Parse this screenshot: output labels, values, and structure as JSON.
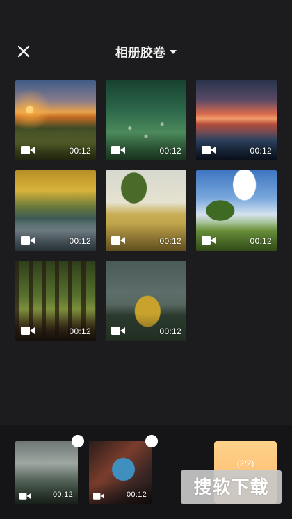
{
  "header": {
    "title": "相册胶卷",
    "close_icon": "close-icon",
    "dropdown_icon": "caret-down-icon"
  },
  "grid": {
    "items": [
      {
        "name": "sunset-field",
        "duration": "00:12"
      },
      {
        "name": "white-flowers",
        "duration": "00:12"
      },
      {
        "name": "sunset-reflection",
        "duration": "00:12"
      },
      {
        "name": "autumn-stream",
        "duration": "00:12"
      },
      {
        "name": "tree-in-field",
        "duration": "00:12"
      },
      {
        "name": "green-tree-sky",
        "duration": "00:12"
      },
      {
        "name": "forest",
        "duration": "00:12"
      },
      {
        "name": "lake-island",
        "duration": "00:12"
      }
    ]
  },
  "selection": {
    "items": [
      {
        "name": "misty-forest",
        "duration": "00:12"
      },
      {
        "name": "canyon-river",
        "duration": "00:12"
      }
    ],
    "next_label": "(2/2)"
  },
  "watermark": "搜软下载",
  "colors": {
    "background": "#1c1c1e",
    "panel": "#151517",
    "accent": "#fbb66a"
  }
}
